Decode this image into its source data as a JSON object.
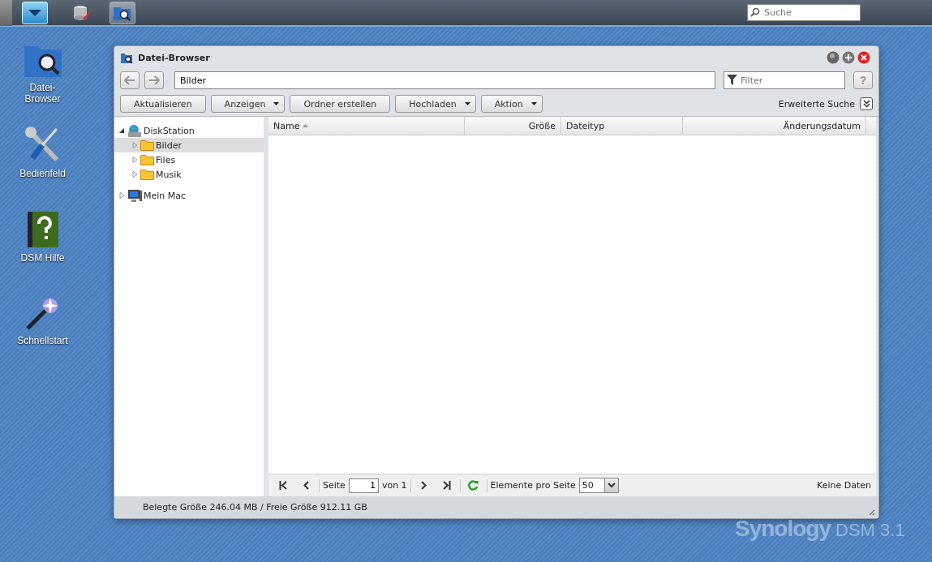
{
  "taskbar": {
    "buttons": [
      {
        "kind": "main-menu",
        "selected": true
      },
      {
        "kind": "storage",
        "selected": false
      },
      {
        "kind": "file-browser",
        "selected": true
      }
    ],
    "search": {
      "placeholder": "Suche"
    }
  },
  "desktop_icons": [
    {
      "kind": "file-browser",
      "label": "Datei-Browser"
    },
    {
      "kind": "control-panel",
      "label": "Bedienfeld"
    },
    {
      "kind": "help",
      "label": "DSM Hilfe"
    },
    {
      "kind": "quick-start",
      "label": "Schnellstart"
    }
  ],
  "window": {
    "title": "Datei-Browser",
    "path": {
      "value": "Bilder"
    },
    "filter": {
      "placeholder": "Filter"
    },
    "help_button": "?",
    "toolbar": [
      {
        "label": "Aktualisieren",
        "dropdown": false
      },
      {
        "label": "Anzeigen",
        "dropdown": true
      },
      {
        "label": "Ordner erstellen",
        "dropdown": false
      },
      {
        "label": "Hochladen",
        "dropdown": true
      },
      {
        "label": "Aktion",
        "dropdown": true
      }
    ],
    "advanced_search": "Erweiterte Suche",
    "tree": [
      {
        "label": "DiskStation",
        "kind": "server",
        "expanded": true,
        "selected": false,
        "children": [
          {
            "label": "Bilder",
            "kind": "folder",
            "expanded": false,
            "selected": true
          },
          {
            "label": "Files",
            "kind": "folder",
            "expanded": false,
            "selected": false
          },
          {
            "label": "Musik",
            "kind": "folder",
            "expanded": false,
            "selected": false
          }
        ]
      },
      {
        "label": "Mein Mac",
        "kind": "computer",
        "expanded": false,
        "selected": false
      }
    ],
    "table": {
      "columns": [
        {
          "label": "Name",
          "sorted": true
        },
        {
          "label": "Größe",
          "sorted": false
        },
        {
          "label": "Dateityp",
          "sorted": false
        },
        {
          "label": "Änderungsdatum",
          "sorted": false
        }
      ]
    },
    "pager": {
      "page_label": "Seite",
      "page": "1",
      "of": "von 1",
      "per_page_label": "Elemente pro Seite",
      "per_page": "50",
      "status": "Keine Daten"
    },
    "status_bar": "Belegte Größe 246.04 MB / Freie Größe 912.11 GB"
  },
  "brand": {
    "name": "Synology",
    "product": "DSM 3.1"
  }
}
